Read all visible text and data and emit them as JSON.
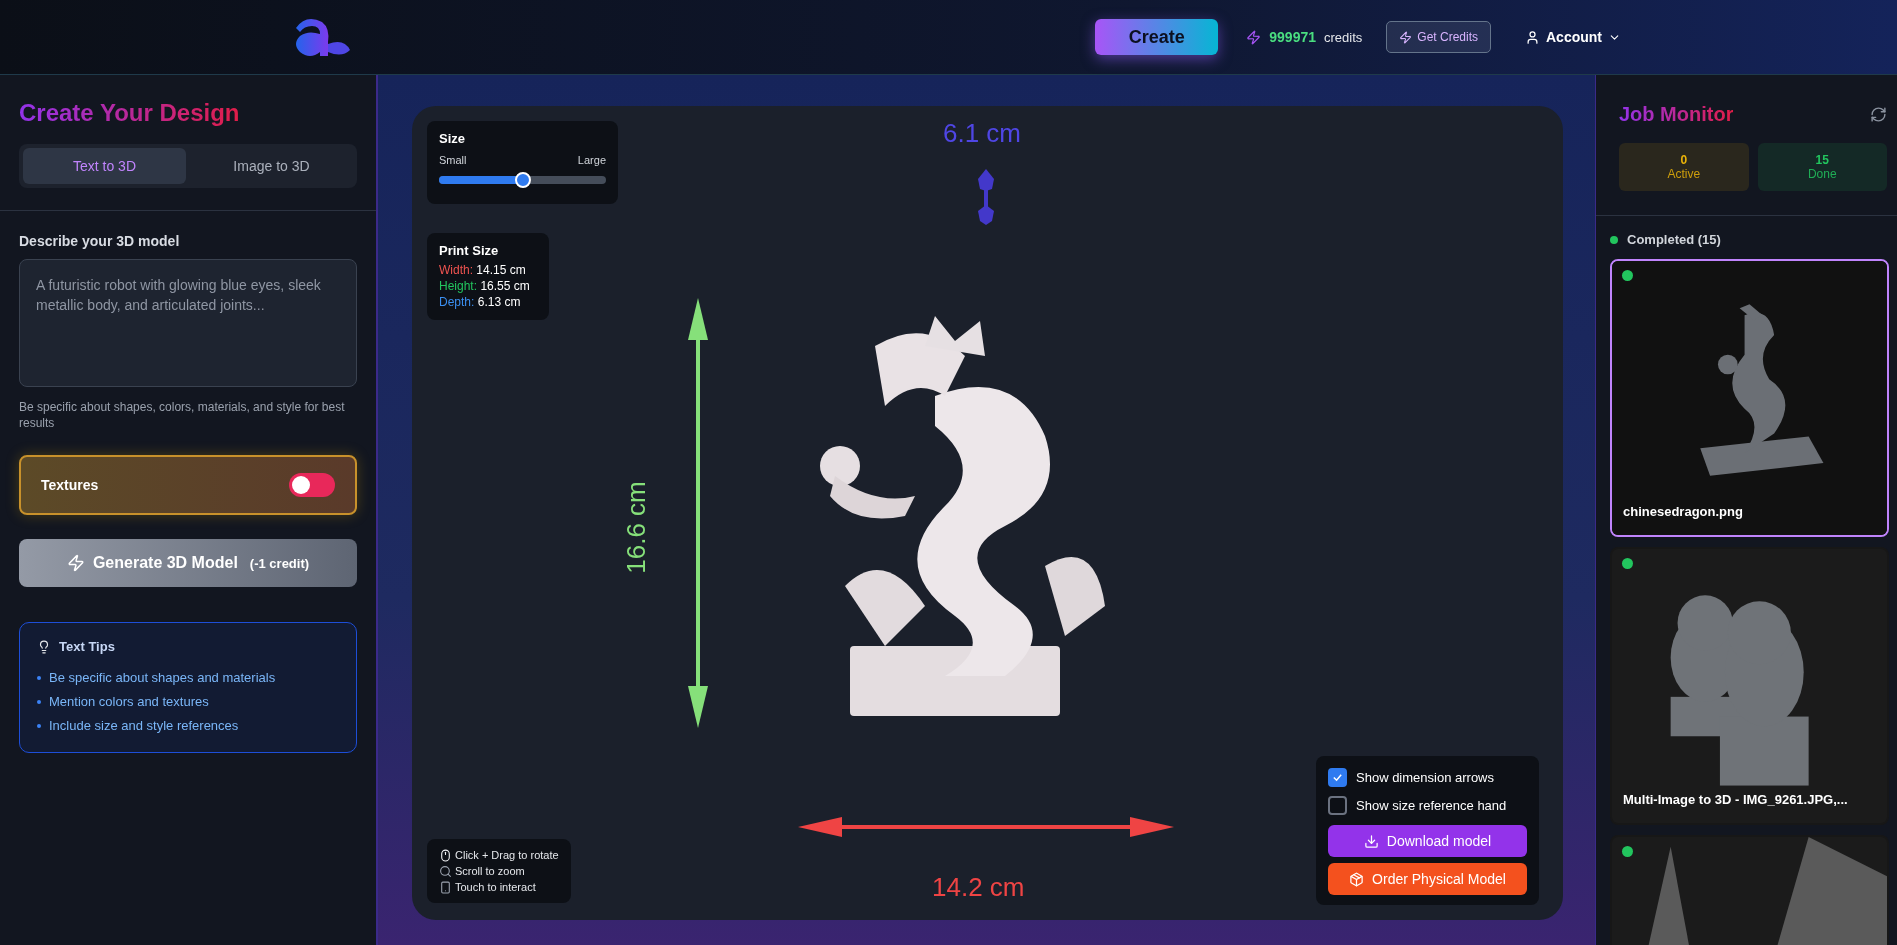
{
  "header": {
    "create_button": "Create",
    "credits_amount": "999971",
    "credits_label": "credits",
    "get_credits_button": "Get Credits",
    "account_menu": "Account"
  },
  "left_panel": {
    "title": "Create Your Design",
    "tabs": [
      {
        "label": "Text to 3D",
        "selected": true
      },
      {
        "label": "Image to 3D",
        "selected": false
      }
    ],
    "prompt_label": "Describe your 3D model",
    "prompt": {
      "placeholder": "A futuristic robot with glowing blue eyes, sleek metallic body, and articulated joints..."
    },
    "prompt_hint": "Be specific about shapes, colors, materials, and style for best results",
    "textures": {
      "label": "Textures",
      "on": false
    },
    "generate_button": {
      "label": "Generate 3D Model",
      "cost": "(-1 credit)"
    },
    "tips": {
      "title": "Text Tips",
      "items": [
        "Be specific about shapes and materials",
        "Mention colors and textures",
        "Include size and style references"
      ]
    }
  },
  "viewer": {
    "size": {
      "title": "Size",
      "min_label": "Small",
      "max_label": "Large",
      "level": 0.5
    },
    "print_size": {
      "title": "Print Size",
      "rows": [
        {
          "label": "Width:",
          "value": "14.15 cm",
          "color": "#ef5350"
        },
        {
          "label": "Height:",
          "value": "16.55 cm",
          "color": "#22c55e"
        },
        {
          "label": "Depth:",
          "value": "6.13 cm",
          "color": "#3b8ff0"
        }
      ]
    },
    "dimensions": {
      "depth": "6.1 cm",
      "height": "16.6 cm",
      "width": "14.2 cm"
    },
    "hints": [
      {
        "kind": "mouse",
        "text": "Click + Drag to rotate"
      },
      {
        "kind": "magnifier",
        "text": "Scroll to zoom"
      },
      {
        "kind": "phone",
        "text": "Touch to interact"
      }
    ],
    "options": [
      {
        "label": "Show dimension arrows",
        "checked": true
      },
      {
        "label": "Show size reference hand",
        "checked": false
      }
    ],
    "download_button": "Download model",
    "order_button": "Order Physical Model"
  },
  "job_monitor": {
    "title": "Job Monitor",
    "stats": [
      {
        "value": "0",
        "label": "Active",
        "color": "#eab308"
      },
      {
        "value": "15",
        "label": "Done",
        "color": "#22c55e"
      }
    ],
    "section": "Completed (15)",
    "jobs": [
      {
        "title": "chinesedragon.png",
        "selected": true,
        "color": "#22c55e"
      },
      {
        "title": "Multi-Image to 3D - IMG_9261.JPG,...",
        "selected": false,
        "color": "#22c55e"
      },
      {
        "selected": false,
        "color": "#22c55e"
      }
    ]
  }
}
